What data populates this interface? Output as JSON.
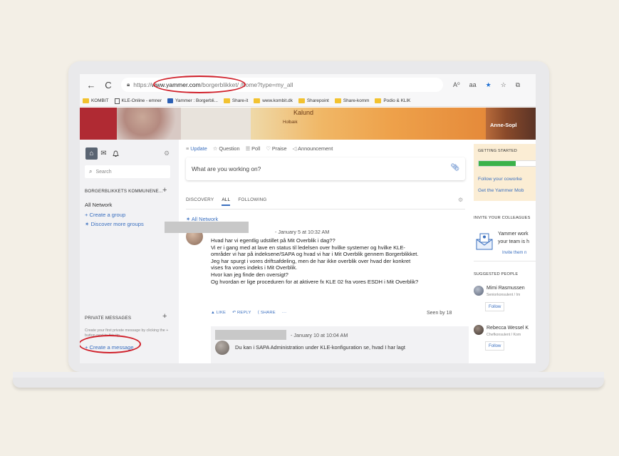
{
  "browser": {
    "back_glyph": "←",
    "reload_glyph": "C",
    "url_prefix": "https://",
    "url_host": "www.yammer.com",
    "url_rest": "/borgerblikket/ /home?type=my_all",
    "icons": [
      "read-aloud-icon",
      "translate-icon",
      "favorite-star-icon",
      "favorites-icon",
      "collections-icon"
    ],
    "addr_icon_glyphs": [
      "A⁰",
      "aa",
      "★",
      "☆",
      "⧉"
    ]
  },
  "bookmarks": [
    {
      "label": "KOMBIT",
      "icon": "folder"
    },
    {
      "label": "KLE-Online - emner",
      "icon": "page"
    },
    {
      "label": "Yammer : Borgerbli...",
      "icon": "yammer"
    },
    {
      "label": "Share-it",
      "icon": "folder"
    },
    {
      "label": "www.kombit.dk",
      "icon": "folder"
    },
    {
      "label": "Sharepoint",
      "icon": "folder"
    },
    {
      "label": "Share-komm",
      "icon": "folder"
    },
    {
      "label": "Podio & KLIK",
      "icon": "folder"
    }
  ],
  "banner": {
    "user_name": "Anne-Sopl",
    "places": [
      "Kalund",
      "Holbæk"
    ]
  },
  "sidebar": {
    "search_placeholder": "Search",
    "network_section": "BORGERBLIKKETS KOMMUNENE...",
    "all_network": "All Network",
    "create_group": "+ Create a group",
    "discover_groups": "✶ Discover more groups",
    "private_messages": "PRIVATE MESSAGES",
    "pm_hint": "Create your first private message by clicking the + button next to this tip.",
    "create_message": "+ Create a message",
    "plus": "+"
  },
  "publisher": {
    "tabs": [
      {
        "icon": "≡",
        "label": "Update"
      },
      {
        "icon": "☆",
        "label": "Question"
      },
      {
        "icon": "☰",
        "label": "Poll"
      },
      {
        "icon": "♡",
        "label": "Praise"
      },
      {
        "icon": "◁",
        "label": "Announcement"
      }
    ],
    "placeholder": "What are you working on?"
  },
  "feed": {
    "tabs": [
      "DISCOVERY",
      "ALL",
      "FOLLOWING"
    ],
    "active_tab": "ALL",
    "network_label": "✶ All Network",
    "post": {
      "timestamp": "- January 5 at 10:32 AM",
      "lines": [
        "Hvad har vi egentlig udstillet på Mit Overblik i dag??",
        "Vi er i gang med at lave en status til ledelsen over hvilke systemer og hvilke KLE-",
        "områder vi har på indeksene/SAPA og hvad vi har i Mit Overblik gennem Borgerblikket.",
        "Jeg har spurgt i vores driftsafdeling, men de har ikke overblik over hvad der konkret",
        "vises fra vores indeks i Mit Overblik.",
        "Hvor kan jeg finde den oversigt?",
        "Og hvordan er lige proceduren for at aktivere fx KLE 02 fra vores ESDH i Mit Overblik?"
      ],
      "actions": [
        "▲ LIKE",
        "↶ REPLY",
        "⟨ SHARE",
        "···"
      ],
      "seen_by": "Seen by 18"
    },
    "reply": {
      "timestamp": "- January 10 at 10:04 AM",
      "text": "Du kan i SAPA Administration under KLE-konfiguration se, hvad I har lagt"
    }
  },
  "right": {
    "getting_started": "GETTING STARTED",
    "progress": 0.62,
    "follow_coworkers": "Follow your coworke",
    "get_mobile": "Get the Yammer Mob",
    "invite_head": "INVITE YOUR COLLEAGUES",
    "invite_line1": "Yammer work",
    "invite_line2": "your team is h",
    "invite_link": "Invite them n",
    "suggested_head": "SUGGESTED PEOPLE",
    "people": [
      {
        "name": "Mimi Rasmussen",
        "title": "Seniorkonsulent / Im",
        "follow": "Follow"
      },
      {
        "name": "Rebecca Wessel K",
        "title": "Chefkonsulent / Kom",
        "follow": "Follow"
      }
    ]
  },
  "colors": {
    "accent": "#3a6fbf",
    "annotation": "#d0202a",
    "progress": "#3bb24a"
  }
}
